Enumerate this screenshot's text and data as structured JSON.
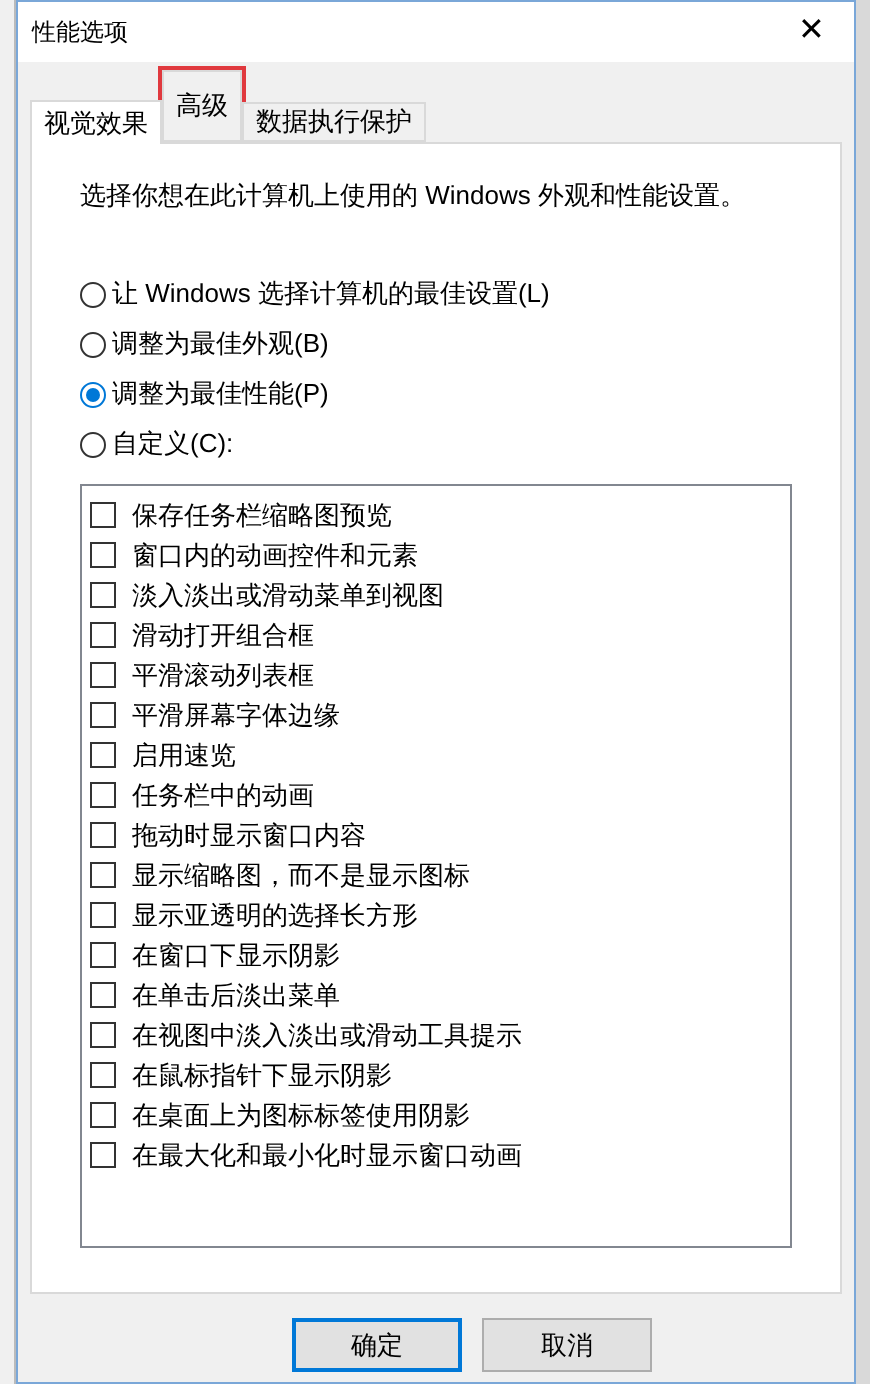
{
  "window": {
    "title": "性能选项",
    "close": "✕"
  },
  "tabs": [
    {
      "label": "视觉效果",
      "selected": true,
      "highlighted": false
    },
    {
      "label": "高级",
      "selected": false,
      "highlighted": true
    },
    {
      "label": "数据执行保护",
      "selected": false,
      "highlighted": false
    }
  ],
  "description": "选择你想在此计算机上使用的 Windows 外观和性能设置。",
  "options": [
    {
      "label": "让 Windows 选择计算机的最佳设置(L)",
      "selected": false
    },
    {
      "label": "调整为最佳外观(B)",
      "selected": false
    },
    {
      "label": "调整为最佳性能(P)",
      "selected": true
    },
    {
      "label": "自定义(C):",
      "selected": false
    }
  ],
  "effects": [
    {
      "label": "保存任务栏缩略图预览",
      "checked": false
    },
    {
      "label": "窗口内的动画控件和元素",
      "checked": false
    },
    {
      "label": "淡入淡出或滑动菜单到视图",
      "checked": false
    },
    {
      "label": "滑动打开组合框",
      "checked": false
    },
    {
      "label": "平滑滚动列表框",
      "checked": false
    },
    {
      "label": "平滑屏幕字体边缘",
      "checked": false
    },
    {
      "label": "启用速览",
      "checked": false
    },
    {
      "label": "任务栏中的动画",
      "checked": false
    },
    {
      "label": "拖动时显示窗口内容",
      "checked": false
    },
    {
      "label": "显示缩略图，而不是显示图标",
      "checked": false
    },
    {
      "label": "显示亚透明的选择长方形",
      "checked": false
    },
    {
      "label": "在窗口下显示阴影",
      "checked": false
    },
    {
      "label": "在单击后淡出菜单",
      "checked": false
    },
    {
      "label": "在视图中淡入淡出或滑动工具提示",
      "checked": false
    },
    {
      "label": "在鼠标指针下显示阴影",
      "checked": false
    },
    {
      "label": "在桌面上为图标标签使用阴影",
      "checked": false
    },
    {
      "label": "在最大化和最小化时显示窗口动画",
      "checked": false
    }
  ],
  "buttons": [
    {
      "label": "确定",
      "default": true
    },
    {
      "label": "取消",
      "default": false
    }
  ]
}
